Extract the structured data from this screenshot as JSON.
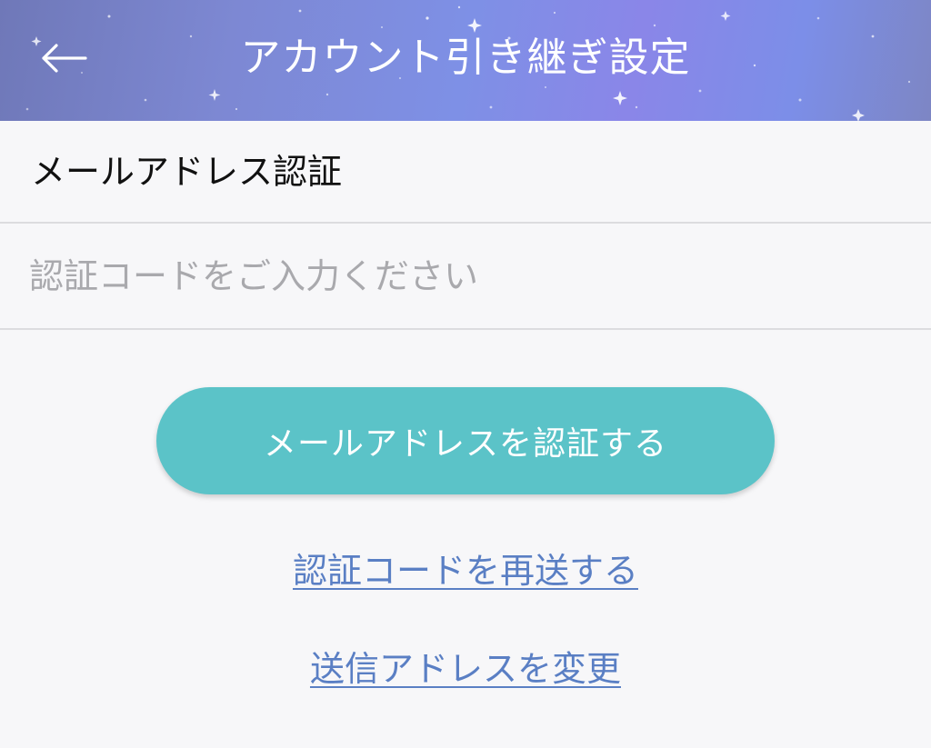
{
  "header": {
    "title": "アカウント引き継ぎ設定",
    "back_icon": "arrow-left-icon",
    "colors": {
      "gradient_from": "#6f78b8",
      "gradient_mid": "#7e90e6",
      "gradient_to": "#7d86c4"
    }
  },
  "section": {
    "label": "メールアドレス認証"
  },
  "code_input": {
    "value": "",
    "placeholder": "認証コードをご入力ください"
  },
  "actions": {
    "verify_label": "メールアドレスを認証する",
    "resend_label": "認証コードを再送する",
    "change_address_label": "送信アドレスを変更"
  },
  "colors": {
    "accent": "#5bc3c8",
    "link": "#5a7fc4",
    "background": "#f7f7f9"
  }
}
